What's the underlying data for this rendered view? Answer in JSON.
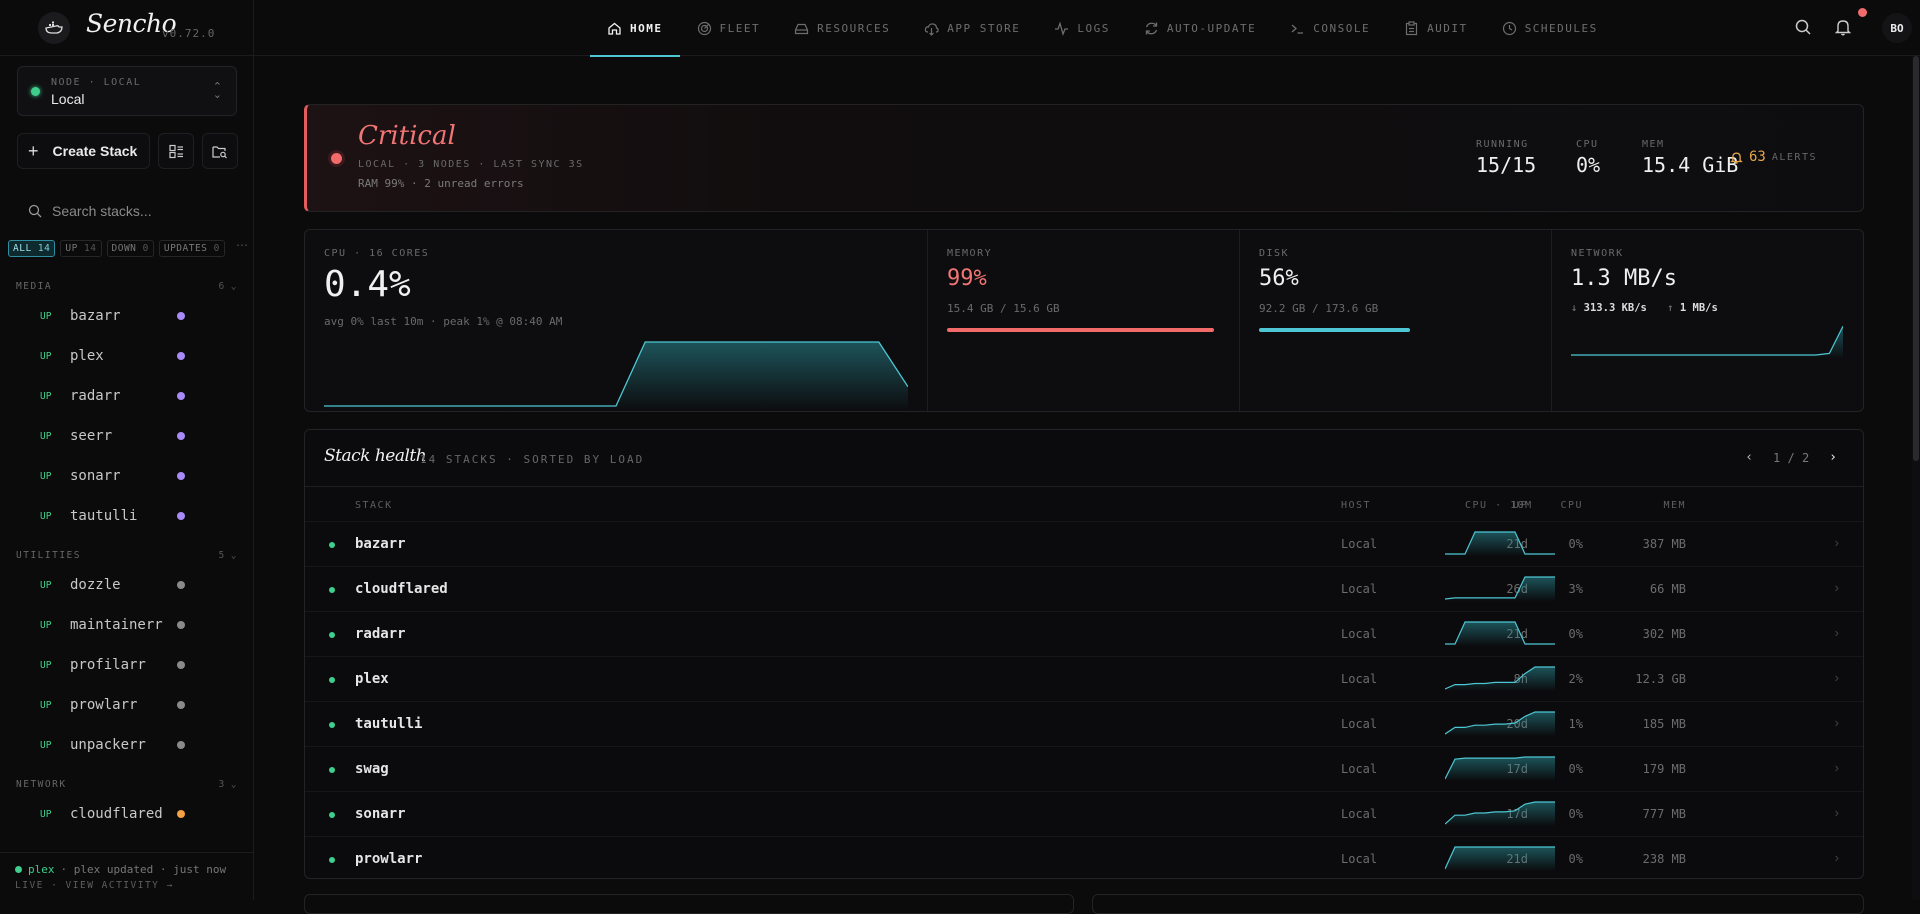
{
  "brand": {
    "name": "Sencho",
    "version": "v0.72.0",
    "logo_icon": "whale-icon"
  },
  "node": {
    "kicker": "NODE · LOCAL",
    "name": "Local"
  },
  "sidebar": {
    "create_label": "Create Stack",
    "search_placeholder": "Search stacks...",
    "filters": [
      {
        "label": "ALL",
        "count": "14",
        "active": true
      },
      {
        "label": "UP",
        "count": "14"
      },
      {
        "label": "DOWN",
        "count": "0"
      },
      {
        "label": "UPDATES",
        "count": "0"
      }
    ],
    "groups": [
      {
        "name": "MEDIA",
        "count": "6",
        "color": "#a78bfa",
        "items": [
          "bazarr",
          "plex",
          "radarr",
          "seerr",
          "sonarr",
          "tautulli"
        ]
      },
      {
        "name": "UTILITIES",
        "count": "5",
        "color": "#8a8a8a",
        "items": [
          "dozzle",
          "maintainerr",
          "profilarr",
          "prowlarr",
          "unpackerr"
        ]
      },
      {
        "name": "NETWORK",
        "count": "3",
        "color": "#f5a043",
        "items": [
          "cloudflared"
        ]
      }
    ],
    "status_label": "UP",
    "footer": {
      "name": "plex",
      "text": "· plex updated · just now",
      "line2": "LIVE · VIEW ACTIVITY →"
    }
  },
  "nav": {
    "tabs": [
      {
        "label": "HOME",
        "icon": "home-icon",
        "active": true
      },
      {
        "label": "FLEET",
        "icon": "radar-icon"
      },
      {
        "label": "RESOURCES",
        "icon": "drive-icon"
      },
      {
        "label": "APP STORE",
        "icon": "cloud-download-icon"
      },
      {
        "label": "LOGS",
        "icon": "activity-icon"
      },
      {
        "label": "AUTO-UPDATE",
        "icon": "refresh-icon"
      },
      {
        "label": "CONSOLE",
        "icon": "terminal-icon"
      },
      {
        "label": "AUDIT",
        "icon": "clipboard-icon"
      },
      {
        "label": "SCHEDULES",
        "icon": "clock-icon"
      }
    ],
    "avatar": "BO"
  },
  "critical": {
    "title": "Critical",
    "meta": "LOCAL · 3 NODES · LAST SYNC 3S",
    "sub": "RAM 99% · 2 unread errors",
    "running_label": "RUNNING",
    "running": "15/15",
    "cpu_label": "CPU",
    "cpu": "0%",
    "mem_label": "MEM",
    "mem": "15.4 GiB",
    "alerts": "63",
    "alerts_label": "ALERTS"
  },
  "metrics": {
    "cpu": {
      "label": "CPU · 16 CORES",
      "value": "0.4%",
      "sub": "avg 0% last 10m · peak 1% @ 08:40 AM",
      "spark": [
        0,
        0,
        0,
        0,
        0,
        0,
        0,
        0,
        0,
        0,
        0,
        1,
        1,
        1,
        1,
        1,
        1,
        1,
        1,
        1,
        0.3
      ]
    },
    "memory": {
      "label": "MEMORY",
      "value": "99%",
      "sub": "15.4 GB / 15.6 GB",
      "fraction": 0.99,
      "color": "#f26a6a"
    },
    "disk": {
      "label": "DISK",
      "value": "56%",
      "sub": "92.2 GB / 173.6 GB",
      "fraction": 0.56,
      "color": "#4dc7d4"
    },
    "network": {
      "label": "NETWORK",
      "value": "1.3 MB/s",
      "down": "313.3 KB/s",
      "up": "1 MB/s",
      "spark": [
        0,
        0,
        0,
        0,
        0,
        0,
        0,
        0,
        0,
        0,
        0,
        0,
        0,
        0,
        0,
        0,
        0,
        0,
        0,
        0.05,
        0.9
      ]
    }
  },
  "health": {
    "title": "Stack health",
    "meta": "14 STACKS · SORTED BY LOAD",
    "page": "1 / 2",
    "columns": {
      "stack": "STACK",
      "host": "HOST",
      "up": "UP",
      "cpu": "CPU",
      "mem": "MEM",
      "trend": "CPU · 10M"
    },
    "rows": [
      {
        "name": "bazarr",
        "host": "Local",
        "up": "21d",
        "cpu": "0%",
        "mem": "387 MB",
        "spark": [
          0,
          0,
          0,
          1,
          1,
          1,
          1,
          1,
          0,
          0,
          0,
          0
        ]
      },
      {
        "name": "cloudflared",
        "host": "Local",
        "up": "26d",
        "cpu": "3%",
        "mem": "66 MB",
        "spark": [
          0,
          0.05,
          0.05,
          0.05,
          0.05,
          0.05,
          0.05,
          0.05,
          1,
          1,
          1,
          1
        ]
      },
      {
        "name": "radarr",
        "host": "Local",
        "up": "21d",
        "cpu": "0%",
        "mem": "302 MB",
        "spark": [
          0,
          0,
          1,
          1,
          1,
          1,
          1,
          1,
          0,
          0,
          0,
          0
        ]
      },
      {
        "name": "plex",
        "host": "Local",
        "up": "8h",
        "cpu": "2%",
        "mem": "12.3 GB",
        "spark": [
          0,
          0.2,
          0.2,
          0.25,
          0.25,
          0.3,
          0.3,
          0.3,
          0.7,
          1,
          1,
          1
        ]
      },
      {
        "name": "tautulli",
        "host": "Local",
        "up": "20d",
        "cpu": "1%",
        "mem": "185 MB",
        "spark": [
          0,
          0.3,
          0.3,
          0.4,
          0.4,
          0.45,
          0.45,
          0.5,
          0.8,
          1,
          1,
          1
        ]
      },
      {
        "name": "swag",
        "host": "Local",
        "up": "17d",
        "cpu": "0%",
        "mem": "179 MB",
        "spark": [
          0,
          0.9,
          0.95,
          0.95,
          0.95,
          0.95,
          0.95,
          0.95,
          1,
          1,
          1,
          1
        ]
      },
      {
        "name": "sonarr",
        "host": "Local",
        "up": "17d",
        "cpu": "0%",
        "mem": "777 MB",
        "spark": [
          0,
          0.4,
          0.4,
          0.5,
          0.5,
          0.55,
          0.55,
          0.6,
          0.9,
          1,
          1,
          1
        ]
      },
      {
        "name": "prowlarr",
        "host": "Local",
        "up": "21d",
        "cpu": "0%",
        "mem": "238 MB",
        "spark": [
          0,
          1,
          1,
          1,
          1,
          1,
          1,
          1,
          1,
          1,
          1,
          1
        ]
      }
    ]
  },
  "colors": {
    "accent": "#4dc7d4",
    "ok": "#3ecf8e",
    "critical": "#f26a6a",
    "warn": "#e5a64a"
  }
}
